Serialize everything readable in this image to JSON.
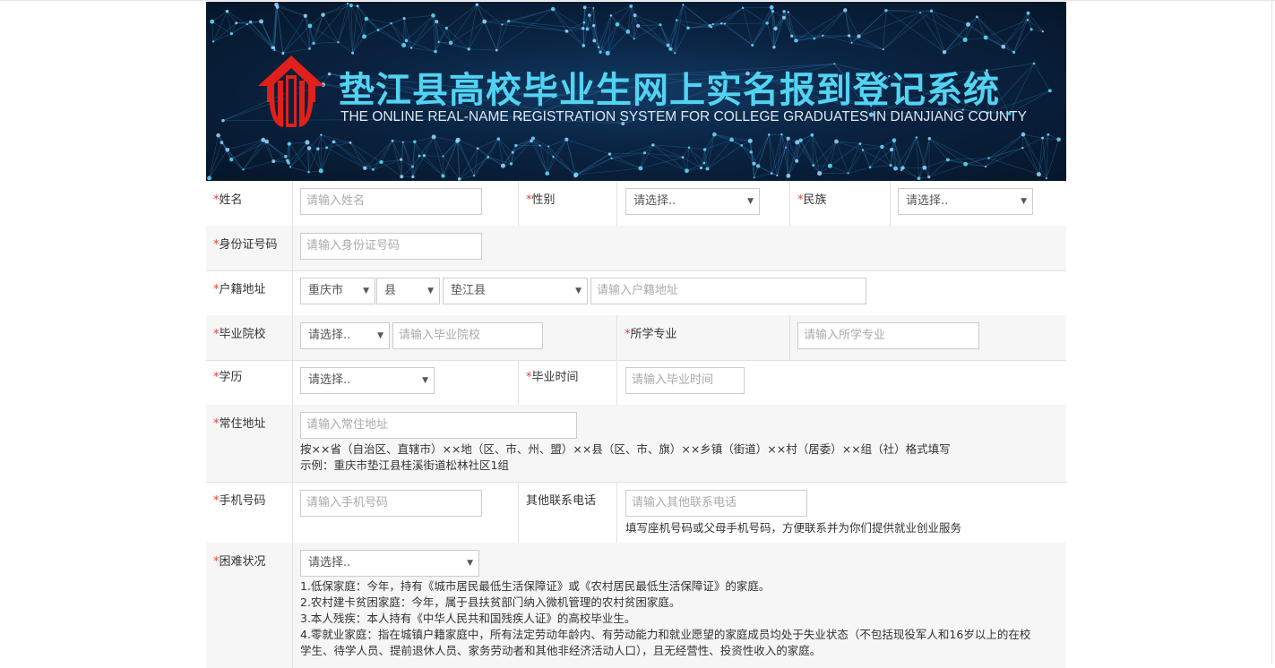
{
  "header": {
    "title_cn": "垫江县高校毕业生网上实名报到登记系统",
    "title_en": "THE ONLINE REAL-NAME REGISTRATION SYSTEM FOR COLLEGE GRADUATES IN DIANJIANG COUNTY",
    "logo_icon": "house-logo-icon"
  },
  "form": {
    "required_mark": "*",
    "name": {
      "label": "姓名",
      "placeholder": "请输入姓名"
    },
    "gender": {
      "label": "性别",
      "value": "请选择.."
    },
    "ethnicity": {
      "label": "民族",
      "value": "请选择.."
    },
    "id_number": {
      "label": "身份证号码",
      "placeholder": "请输入身份证号码"
    },
    "household": {
      "label": "户籍地址",
      "province": "重庆市",
      "city": "县",
      "county": "垫江县",
      "placeholder": "请输入户籍地址"
    },
    "school": {
      "label": "毕业院校",
      "select_value": "请选择..",
      "placeholder": "请输入毕业院校"
    },
    "major": {
      "label": "所学专业",
      "placeholder": "请输入所学专业"
    },
    "education": {
      "label": "学历",
      "value": "请选择.."
    },
    "grad_time": {
      "label": "毕业时间",
      "placeholder": "请输入毕业时间"
    },
    "residence": {
      "label": "常住地址",
      "placeholder": "请输入常住地址",
      "hint1": "按××省（自治区、直辖市）××地（区、市、州、盟）××县（区、市、旗）××乡镇（街道）××村（居委）××组（社）格式填写",
      "hint2": "示例：重庆市垫江县桂溪街道松林社区1组"
    },
    "phone": {
      "label": "手机号码",
      "placeholder": "请输入手机号码"
    },
    "other_phone": {
      "label": "其他联系电话",
      "placeholder": "请输入其他联系电话",
      "hint": "填写座机号码或父母手机号码，方便联系并为你们提供就业创业服务"
    },
    "hardship": {
      "label": "困难状况",
      "value": "请选择..",
      "notes": [
        "1.低保家庭：今年，持有《城市居民最低生活保障证》或《农村居民最低生活保障证》的家庭。",
        "2.农村建卡贫困家庭：今年，属于县扶贫部门纳入微机管理的农村贫困家庭。",
        "3.本人残疾：本人持有《中华人民共和国残疾人证》的高校毕业生。",
        "4.零就业家庭：指在城镇户籍家庭中，所有法定劳动年龄内、有劳动能力和就业愿望的家庭成员均处于失业状态（不包括现役军人和16岁以上的在校",
        "学生、待学人员、提前退休人员、家务劳动者和其他非经济活动人口），且无经营性、投资性收入的家庭。"
      ]
    }
  },
  "colors": {
    "banner_bg": "#0a2342",
    "title_cn": "#52d3f2",
    "logo_red": "#e0201b",
    "required": "#e53c3c",
    "border": "#e2e2e2"
  }
}
